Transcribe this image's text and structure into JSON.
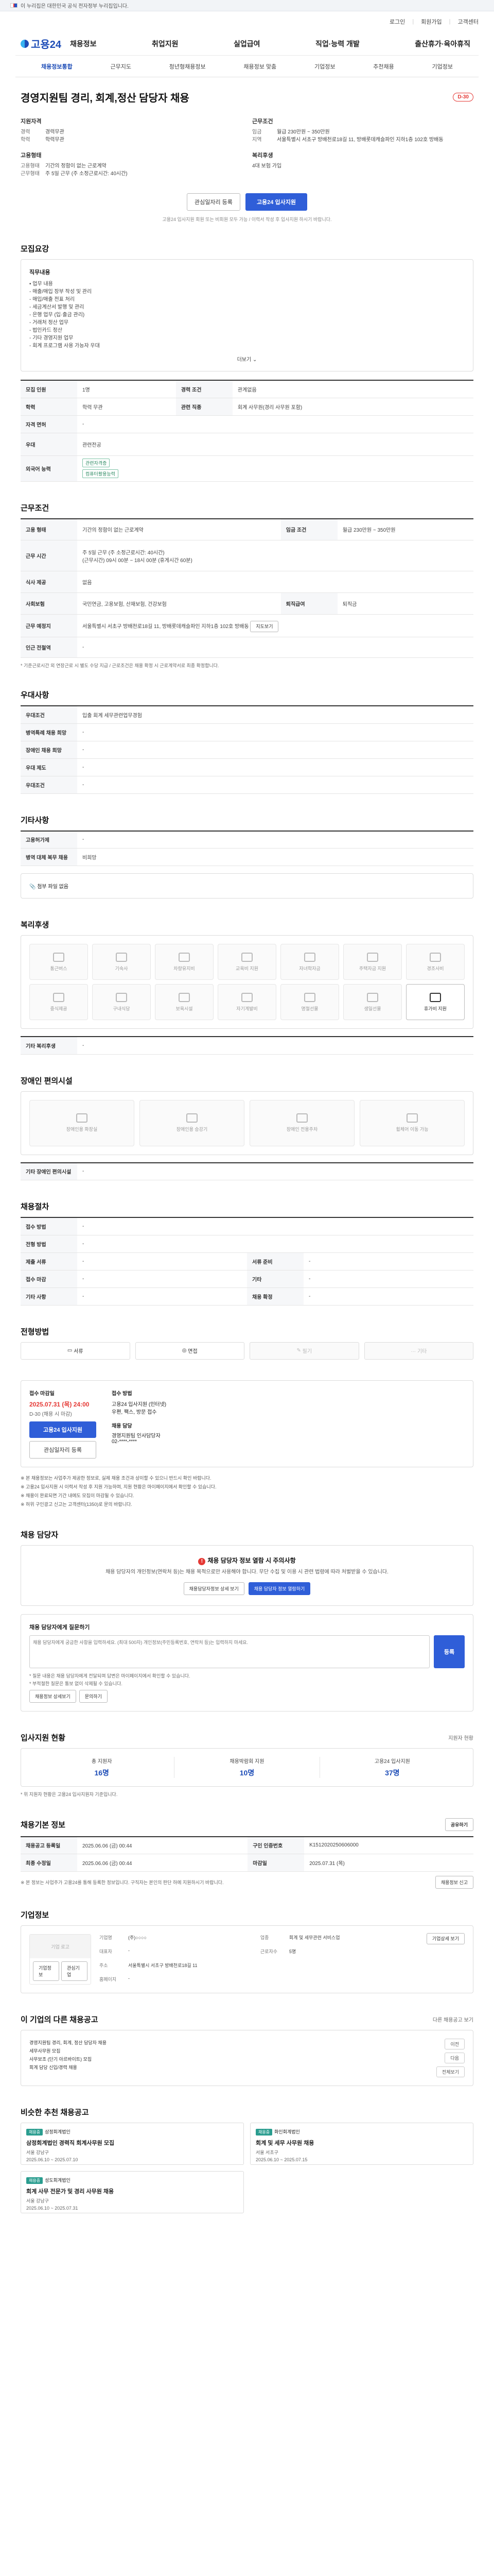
{
  "gov_banner": "이 누리집은 대한민국 공식 전자정부 누리집입니다.",
  "util": [
    "로그인",
    "회원가입",
    "고객센터"
  ],
  "brand": "고용24",
  "gnb": [
    "채용정보",
    "취업지원",
    "실업급여",
    "직업·능력 개발",
    "출산휴가·육아휴직"
  ],
  "subnav": [
    "채용정보통합",
    "근무지도",
    "청년형채용정보",
    "채용정보 맞춤",
    "기업정보",
    "추천채용",
    "기업정보"
  ],
  "job": {
    "title": "경영지원팀 경리, 회계,정산 담당자 채용",
    "dday": "D-30",
    "req_title": "지원자격",
    "req": [
      [
        "경력",
        "경력무관"
      ],
      [
        "학력",
        "학력무관"
      ]
    ],
    "cond_title": "근무조건",
    "cond": [
      [
        "임금",
        "월급 230만원 ~ 350만원"
      ],
      [
        "지역",
        "서울특별시 서초구 방배천로18길 11, 방배롯데캐슬파인 지하1층 102호 방배동"
      ]
    ],
    "corp_title": "고용형태",
    "corp": [
      [
        "고용형태",
        "기간의 정함이 없는 근로계약"
      ],
      [
        "근무형태",
        "주 5일 근무 (주 소정근로시간: 40시간)"
      ]
    ],
    "welfare_title": "복리후생",
    "welfare": [
      [
        "",
        "4대 보험 가입"
      ]
    ],
    "btn_scrap": "관심일자리 등록",
    "btn_apply": "고용24 입사지원",
    "apply_notice": "고용24 입사지원 회원 또는 비회원 모두 가능 / 이력서 작성 후 입사지원 하시기 바랍니다."
  },
  "duty": {
    "title": "모집요강",
    "heading": "직무내용",
    "lines": [
      "• 업무 내용",
      "- 매출/매입 장부 작성 및 관리",
      "- 매입/매출 전표 처리",
      "- 세금계산서 발행 및 관리",
      "- 은행 업무 (입·출금 관리)",
      "- 거래처 정산 업무",
      "- 법인카드 정산",
      "- 기타 경영지원 업무",
      "- 회계 프로그램 사용 가능자 우대"
    ],
    "more": "더보기"
  },
  "recruit_table": [
    [
      "모집 인원",
      "1명",
      "경력 조건",
      "관계없음"
    ],
    [
      "학력",
      "학력 무관",
      "관련 직종",
      "회계 사무원(경리 사무원 포함)"
    ],
    [
      "자격 면허",
      "-",
      "",
      ""
    ],
    [
      "우대",
      "관련전공",
      "",
      ""
    ],
    [
      "외국어 능력",
      "-",
      "",
      ""
    ]
  ],
  "recruit_tags": [
    "관련자격증",
    "컴퓨터활용능력"
  ],
  "work": {
    "title": "근무조건",
    "rows": [
      [
        "고용 형태",
        "기간의 정함이 없는 근로계약",
        "임금 조건",
        "월급 230만원 ~ 350만원"
      ],
      [
        "근무 시간",
        "주 5일 근무 (주 소정근로시간: 40시간)",
        "",
        ""
      ],
      [
        "식사 제공",
        "없음",
        "",
        ""
      ],
      [
        "사회보험",
        "국민연금, 고용보험, 산재보험, 건강보험",
        "퇴직급여",
        "퇴직금"
      ],
      [
        "근무 예정지",
        "서울특별시 서초구 방배천로18길 11, 방배롯데캐슬파인 지하1층 102호 방배동",
        "",
        ""
      ],
      [
        "인근 전철역",
        "-",
        "",
        ""
      ]
    ],
    "hours": "(근무시간) 09시 00분 ~ 18시 00분 (휴게시간 60분)",
    "map_label": "지도보기",
    "note": "* 기준근로시간 외 연장근로 시 별도 수당 지급 / 근로조건은 채용 확정 시 근로계약서로 최종 확정합니다."
  },
  "benefit": {
    "title": "우대사항",
    "rows": [
      [
        "우대조건",
        "입출 회계 세무관련업무경험"
      ],
      [
        "병역특례 채용 희망",
        "-"
      ],
      [
        "장애인 채용 희망",
        "-"
      ],
      [
        "우대 제도",
        "-"
      ],
      [
        "우대조건",
        "-"
      ]
    ]
  },
  "etc": {
    "title": "기타사항",
    "rows": [
      [
        "고용허가제",
        "-"
      ],
      [
        "병역 대체 복무 채용",
        "비희망"
      ]
    ],
    "attach": "첨부 파일 없음"
  },
  "welfare": {
    "title": "복리후생",
    "tiles": [
      "통근버스",
      "기숙사",
      "차량유지비",
      "교육비 지원",
      "자녀학자금",
      "주택자금 지원",
      "경조사비",
      "중식제공",
      "구내식당",
      "보육시설",
      "자기계발비",
      "명절선물",
      "생일선물",
      "휴가비 지원"
    ],
    "etc_label": "기타 복리후생",
    "etc_val": "-"
  },
  "disability": {
    "title": "장애인 편의시설",
    "tiles": [
      "장애인용 화장실",
      "장애인용 승강기",
      "장애인 전용주차",
      "휠체어 이동 가능"
    ],
    "etc_label": "기타 장애인 편의시설",
    "etc_val": "-"
  },
  "process": {
    "title": "채용절차",
    "rows": [
      [
        "접수 방법",
        "-",
        "",
        ""
      ],
      [
        "전형 방법",
        "-",
        "",
        ""
      ],
      [
        "제출 서류",
        "-",
        "서류 준비",
        "-"
      ],
      [
        "접수 마감",
        "-",
        "기타",
        "-"
      ],
      [
        "기타 사항",
        "-",
        "채용 확정",
        "-"
      ]
    ]
  },
  "method": {
    "title": "전형방법",
    "items": [
      "서류",
      "면접",
      "필기",
      "기타"
    ]
  },
  "deadline": {
    "label1": "접수 마감일",
    "date": "2025.07.31 (목) 24:00",
    "state": "D-30 (채용 시 마감)",
    "label2": "접수 방법",
    "method": "고용24 입사지원 (인터넷)",
    "method2": "우편, 팩스, 방문 접수",
    "contact_label": "채용 담당",
    "contact": "경영지원팀 인사담당자",
    "phone": "02-****-****",
    "btn_apply": "고용24 입사지원",
    "btn_scrap": "관심일자리 등록"
  },
  "deadline_notes": [
    "※ 본 채용정보는 사업주가 제공한 정보로, 실제 채용 조건과 상이할 수 있으니 반드시 확인 바랍니다.",
    "※ 고용24 입사지원 시 이력서 작성 후 지원 가능하며, 지원 현황은 마이페이지에서 확인할 수 있습니다.",
    "※ 채용이 완료되면 기간 내에도 모집이 마감될 수 있습니다.",
    "※ 허위 구인광고 신고는 고객센터(1350)로 문의 바랍니다."
  ],
  "warn": {
    "title": "채용 담당자 정보 열람 시 주의사항",
    "desc": "채용 담당자의 개인정보(연락처 등)는 채용 목적으로만 사용해야 합니다. 무단 수집 및 이용 시 관련 법령에 따라 처벌받을 수 있습니다.",
    "btn1": "채용담당자정보 상세 보기",
    "btn2": "채용 담당자 정보 열람하기"
  },
  "inquiry": {
    "title": "채용 담당자에게 질문하기",
    "placeholder": "채용 담당자에게 궁금한 사항을 입력하세요. (최대 500자) 개인정보(주민등록번호, 연락처 등)는 입력하지 마세요.",
    "btn": "등록",
    "notes": [
      "* 질문 내용은 채용 담당자에게 전달되며 답변은 마이페이지에서 확인할 수 있습니다.",
      "* 부적절한 질문은 통보 없이 삭제될 수 있습니다."
    ],
    "links": [
      "채용정보 상세보기",
      "문의하기"
    ]
  },
  "stats": {
    "title": "입사지원 현황",
    "aside": "지원자 현황",
    "items": [
      [
        "총 지원자",
        "16명"
      ],
      [
        "채용박람회 지원",
        "10명"
      ],
      [
        "고용24 입사지원",
        "37명"
      ]
    ],
    "note": "* 위 지원자 현황은 고용24 입사지원자 기준입니다."
  },
  "info": {
    "title": "채용기본 정보",
    "aside": "공유하기",
    "rows": [
      [
        "채용공고 등록일",
        "2025.06.06 (금) 00:44",
        "구인 인증번호",
        "K1512020250606000"
      ],
      [
        "최종 수정일",
        "2025.06.06 (금) 00:44",
        "마감일",
        "2025.07.31 (목)"
      ]
    ],
    "btn": "채용정보 신고",
    "note": "※ 본 정보는 사업주가 고용24를 통해 등록한 정보입니다. 구직자는 본인의 판단 하에 지원하시기 바랍니다."
  },
  "company": {
    "title": "기업정보",
    "logo_label": "기업 로고",
    "btns": [
      "기업정보",
      "관심기업"
    ],
    "rows": [
      [
        "기업명",
        "(주)○○○○",
        "업종",
        "회계 및 세무관련 서비스업"
      ],
      [
        "대표자",
        "-",
        "근로자수",
        "5명"
      ],
      [
        "주소",
        "서울특별시 서초구 방배천로18길 11",
        "",
        ""
      ],
      [
        "홈페이지",
        "-",
        "",
        ""
      ]
    ],
    "link_btn": "기업상세 보기"
  },
  "other": {
    "title": "이 기업의 다른 채용공고",
    "aside": "다른 채용공고 보기",
    "list": [
      "경영지원팀 경리, 회계, 정산 담당자 채용",
      "세무사무원 모집",
      "사무보조 (단기 아르바이트) 모집",
      "회계 담당 신입/경력 채용"
    ],
    "pager": [
      "이전",
      "다음",
      "전체보기"
    ]
  },
  "recommend": {
    "title": "비슷한 추천 채용공고",
    "cards": [
      {
        "badge": "채용중",
        "org": "삼정회계법인",
        "title": "삼정회계법인 경력직 회계사무원 모집",
        "loc": "서울 강남구",
        "date": "2025.06.10 ~ 2025.07.10"
      },
      {
        "badge": "채용중",
        "org": "화인회계법인",
        "title": "회계 및 세무 사무원 채용",
        "loc": "서울 서초구",
        "date": "2025.06.10 ~ 2025.07.15"
      },
      {
        "badge": "채용중",
        "org": "성도회계법인",
        "title": "회계 사무 전문가 및 경리 사무원 채용",
        "loc": "서울 강남구",
        "date": "2025.06.10 ~ 2025.07.31"
      }
    ]
  }
}
